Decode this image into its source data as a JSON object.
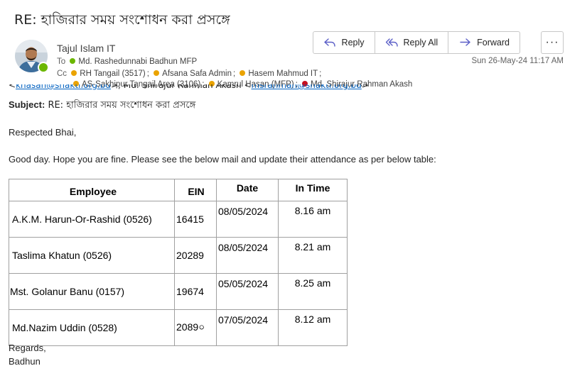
{
  "subject": "RE: হাজিরার সময় সংশোধন করা প্রসঙ্গে",
  "actions": {
    "reply": "Reply",
    "reply_all": "Reply All",
    "forward": "Forward",
    "more": "···"
  },
  "sender": {
    "name": "Tajul Islam IT",
    "status_color": "#6bb700"
  },
  "sent_date": "Sun 26-May-24 11:17 AM",
  "to": {
    "label": "To",
    "recipients": [
      {
        "name": "Md. Rashedunnabi Badhun MFP",
        "status": "green"
      }
    ]
  },
  "cc": {
    "label": "Cc",
    "recipients": [
      {
        "name": "RH Tangail (3517)",
        "status": "yellow"
      },
      {
        "name": "Afsana Safa Admin",
        "status": "yellow"
      },
      {
        "name": "Hasem Mahmud IT",
        "status": "yellow"
      },
      {
        "name": "AS-Sakhipur Tangail Area (3106)",
        "status": "yellow"
      },
      {
        "name": "Kamrul Hasan (MFP)",
        "status": "yellow"
      },
      {
        "name": "Md. Shirajur Rahman Akash",
        "status": "red"
      }
    ]
  },
  "quoted_header": {
    "prefix": "<",
    "link1": "khasan@shakti.org.bd",
    "middle": ">; Md. Shirajur Rahman Akash <",
    "link2": "msrahman@shakti.org.bd",
    "suffix": ">"
  },
  "body": {
    "subject_label": "Subject:",
    "subject_value": "RE: হাজিরার সময় সংশোধন করা প্রসঙ্গে",
    "greeting": "Respected Bhai,",
    "intro": "Good day. Hope you are fine. Please see the below mail and update their attendance as per below table:",
    "closing": "Regards,",
    "signature": "Badhun"
  },
  "table": {
    "headers": [
      "Employee",
      "EIN",
      "Date",
      "In Time"
    ],
    "rows": [
      [
        "A.K.M. Harun-Or-Rashid (0526)",
        "16415",
        "08/05/2024",
        "8.16 am"
      ],
      [
        "Taslima Khatun (0526)",
        "20289",
        "08/05/2024",
        "8.21 am"
      ],
      [
        "Mst. Golanur Banu (0157)",
        "19674",
        "05/05/2024",
        "8.25 am"
      ],
      [
        "Md.Nazim Uddin (0528)",
        "2089০",
        "07/05/2024",
        "8.12 am"
      ]
    ]
  }
}
